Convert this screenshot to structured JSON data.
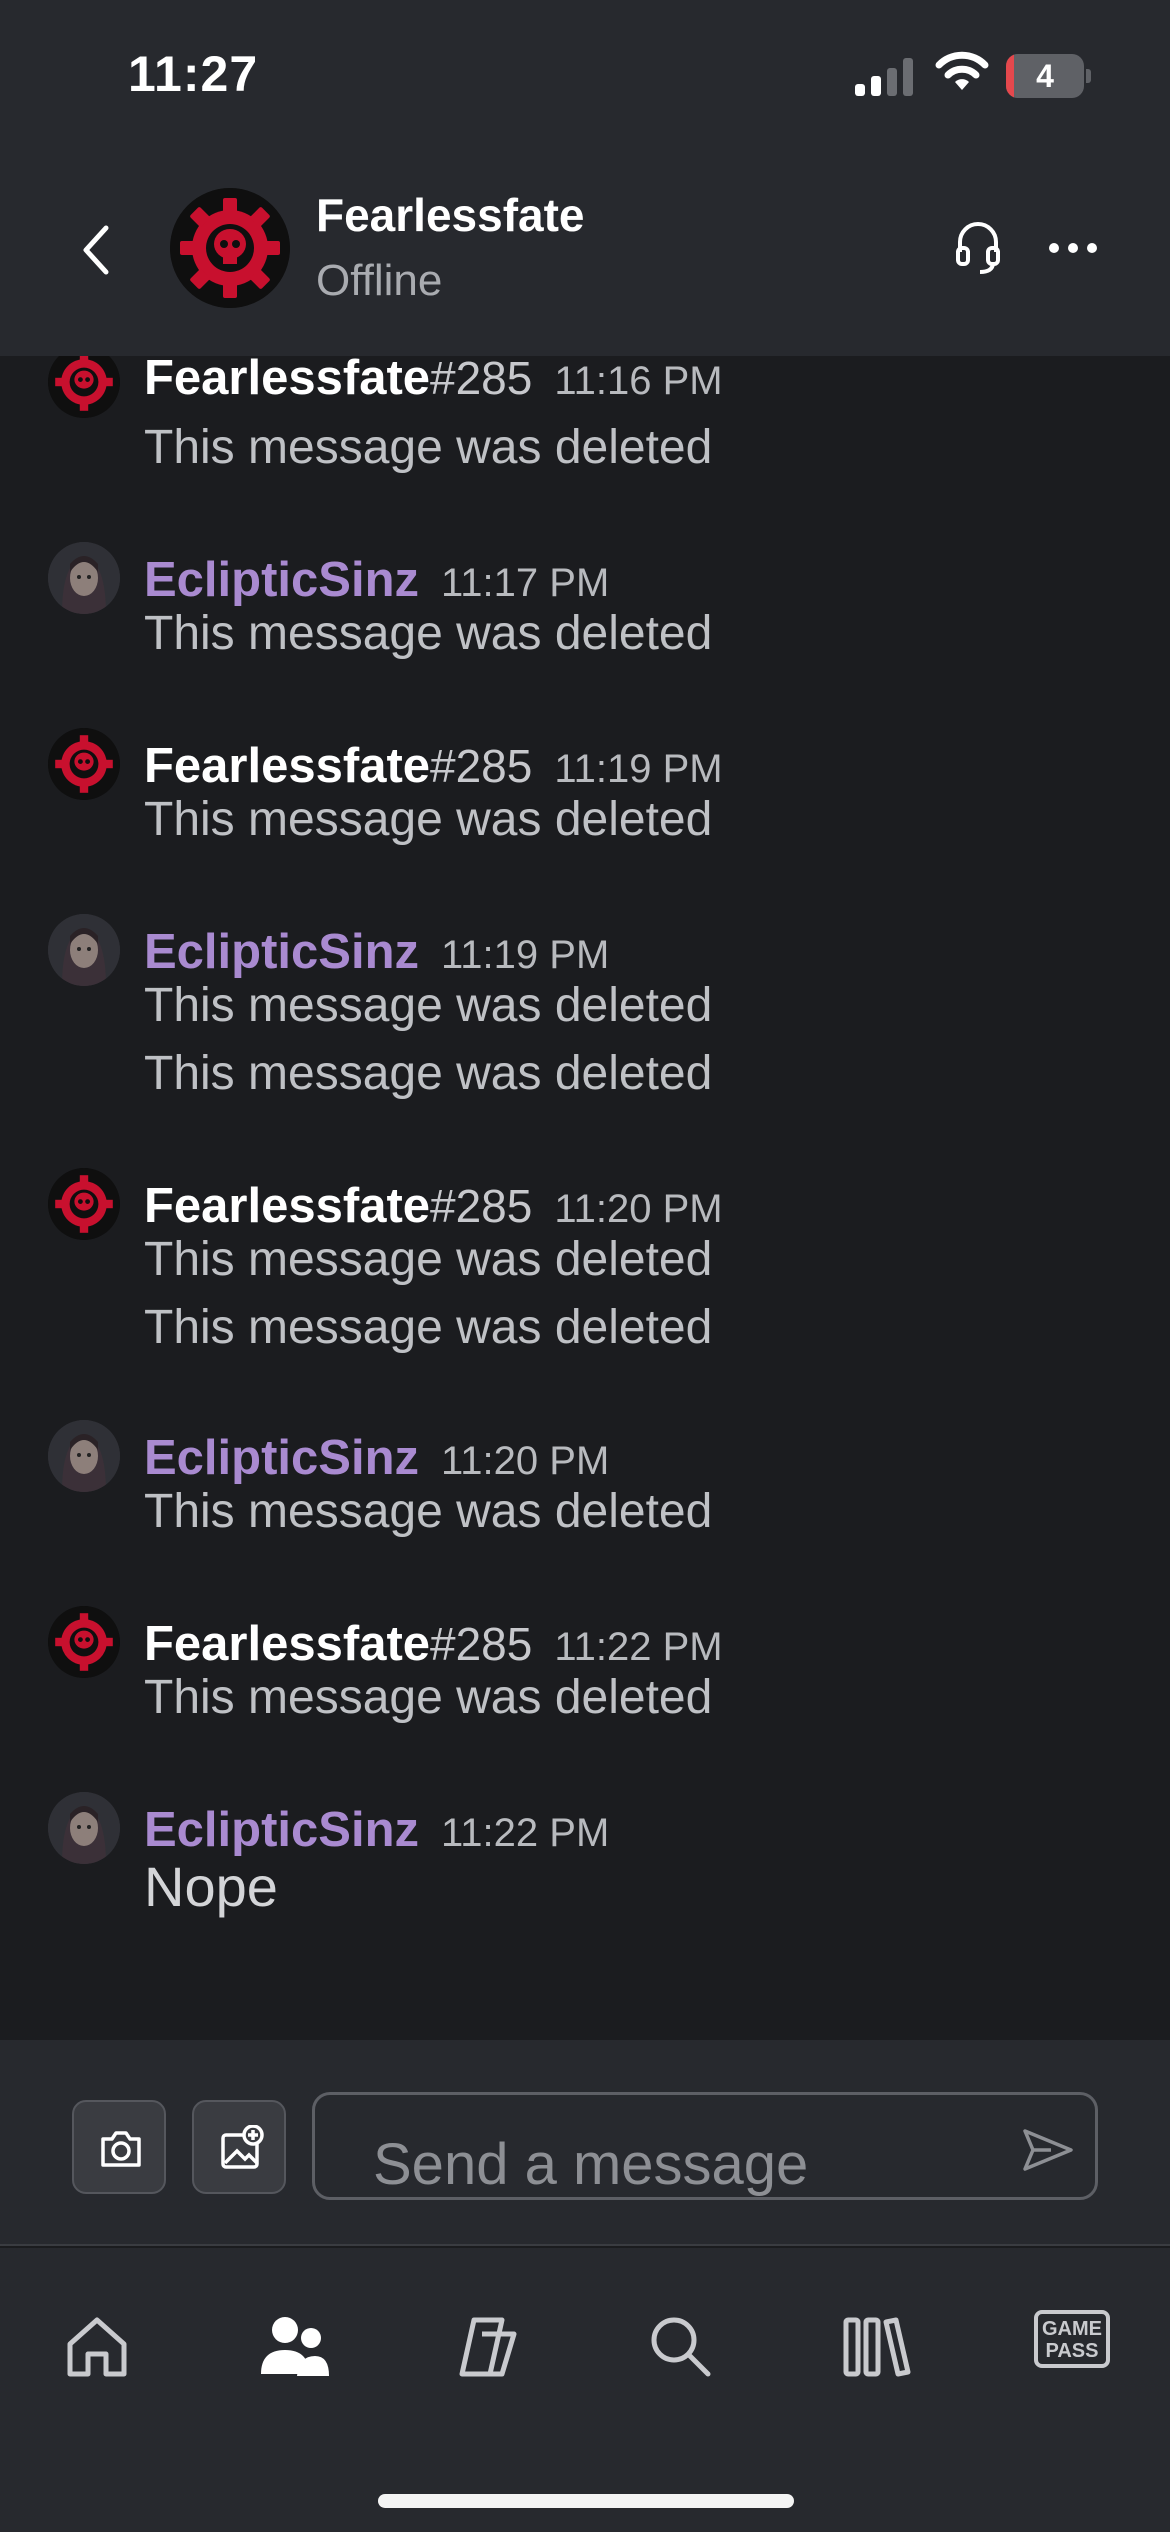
{
  "status_bar": {
    "time": "11:27",
    "battery_level": "4"
  },
  "header": {
    "name": "Fearlessfate",
    "status": "Offline"
  },
  "messages": [
    {
      "user": "Fearlessfate",
      "tag": "#285",
      "time": "11:16 PM",
      "lines": [
        "This message was deleted"
      ]
    },
    {
      "user": "EclipticSinz",
      "tag": "",
      "time": "11:17 PM",
      "lines": [
        "This message was deleted"
      ]
    },
    {
      "user": "Fearlessfate",
      "tag": "#285",
      "time": "11:19 PM",
      "lines": [
        "This message was deleted"
      ]
    },
    {
      "user": "EclipticSinz",
      "tag": "",
      "time": "11:19 PM",
      "lines": [
        "This message was deleted",
        "This message was deleted"
      ]
    },
    {
      "user": "Fearlessfate",
      "tag": "#285",
      "time": "11:20 PM",
      "lines": [
        "This message was deleted",
        "This message was deleted"
      ]
    },
    {
      "user": "EclipticSinz",
      "tag": "",
      "time": "11:20 PM",
      "lines": [
        "This message was deleted"
      ]
    },
    {
      "user": "Fearlessfate",
      "tag": "#285",
      "time": "11:22 PM",
      "lines": [
        "This message was deleted"
      ]
    },
    {
      "user": "EclipticSinz",
      "tag": "",
      "time": "11:22 PM",
      "lines": [
        "Nope"
      ]
    }
  ],
  "composer": {
    "placeholder": "Send a message"
  },
  "nav": {
    "items": [
      "home-icon",
      "people-icon",
      "copilot-icon",
      "search-icon",
      "library-icon",
      "game-pass-icon"
    ],
    "game_pass_line1": "GAME",
    "game_pass_line2": "PASS"
  },
  "colors": {
    "accent_purple": "#a98ad0",
    "background": "#1b1c1f",
    "header": "#27292e",
    "gear_red": "#c8102e"
  }
}
